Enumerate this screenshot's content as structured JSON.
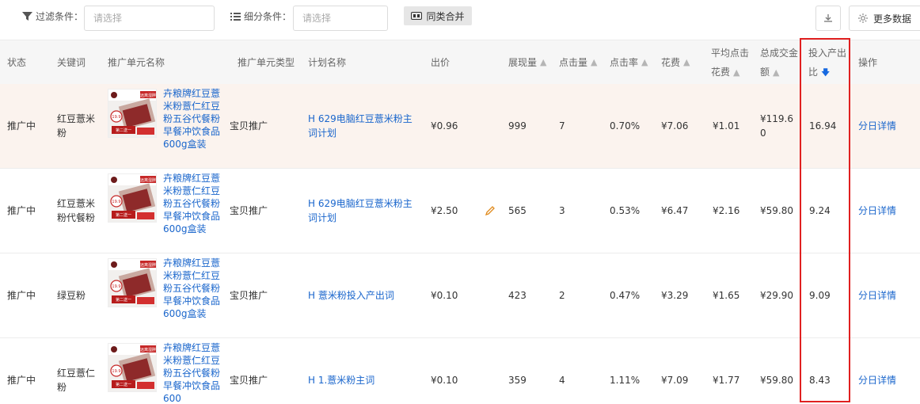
{
  "toolbar": {
    "filter_label": "过滤条件：",
    "filter_placeholder": "请选择",
    "segment_label": "细分条件：",
    "segment_placeholder": "请选择",
    "merge_label": "同类合并",
    "more_label": "更多数据"
  },
  "table": {
    "headers": {
      "status": "状态",
      "keyword": "关键词",
      "unit_name": "推广单元名称",
      "unit_type": "推广单元类型",
      "plan_name": "计划名称",
      "bid": "出价",
      "impressions": "展现量",
      "clicks": "点击量",
      "ctr": "点击率",
      "cost": "花费",
      "avg_cpc_1": "平均点击",
      "avg_cpc_2": "花费",
      "gmv_1": "总成交金",
      "gmv_2": "额",
      "roi_1": "投入产出",
      "roi_2": "比",
      "action": "操作"
    },
    "rows": [
      {
        "status": "推广中",
        "keyword": "红豆薏米粉",
        "unit_name": "卉粮牌红豆薏米粉薏仁红豆粉五谷代餐粉早餐冲饮食品600g盒装",
        "unit_type": "宝贝推广",
        "plan_name": "H 629电脑红豆薏米粉主词计划",
        "bid": "¥0.96",
        "impressions": "999",
        "clicks": "7",
        "ctr": "0.70%",
        "cost": "¥7.06",
        "avg_cpc": "¥1.01",
        "gmv": "¥119.60",
        "roi": "16.94",
        "action": "分日详情"
      },
      {
        "status": "推广中",
        "keyword": "红豆薏米粉代餐粉",
        "unit_name": "卉粮牌红豆薏米粉薏仁红豆粉五谷代餐粉早餐冲饮食品600g盒装",
        "unit_type": "宝贝推广",
        "plan_name": "H 629电脑红豆薏米粉主词计划",
        "bid": "¥2.50",
        "impressions": "565",
        "clicks": "3",
        "ctr": "0.53%",
        "cost": "¥6.47",
        "avg_cpc": "¥2.16",
        "gmv": "¥59.80",
        "roi": "9.24",
        "action": "分日详情"
      },
      {
        "status": "推广中",
        "keyword": "绿豆粉",
        "unit_name": "卉粮牌红豆薏米粉薏仁红豆粉五谷代餐粉早餐冲饮食品600g盒装",
        "unit_type": "宝贝推广",
        "plan_name": "H 薏米粉投入产出词",
        "bid": "¥0.10",
        "impressions": "423",
        "clicks": "2",
        "ctr": "0.47%",
        "cost": "¥3.29",
        "avg_cpc": "¥1.65",
        "gmv": "¥29.90",
        "roi": "9.09",
        "action": "分日详情"
      },
      {
        "status": "推广中",
        "keyword": "红豆薏仁粉",
        "unit_name": "卉粮牌红豆薏米粉薏仁红豆粉五谷代餐粉早餐冲饮食品600",
        "unit_type": "宝贝推广",
        "plan_name": "H 1.薏米粉主词",
        "bid": "¥0.10",
        "impressions": "359",
        "clicks": "4",
        "ctr": "1.11%",
        "cost": "¥7.09",
        "avg_cpc": "¥1.77",
        "gmv": "¥59.80",
        "roi": "8.43",
        "action": "分日详情"
      }
    ],
    "thumb_text": {
      "promo": "远离湿胖",
      "price": "19.9",
      "second": "第二送一"
    }
  },
  "colors": {
    "link": "#1a66cc",
    "highlight_row": "#fbf3ee",
    "sort_active": "#1769e0",
    "annotation_box": "#e02020"
  }
}
